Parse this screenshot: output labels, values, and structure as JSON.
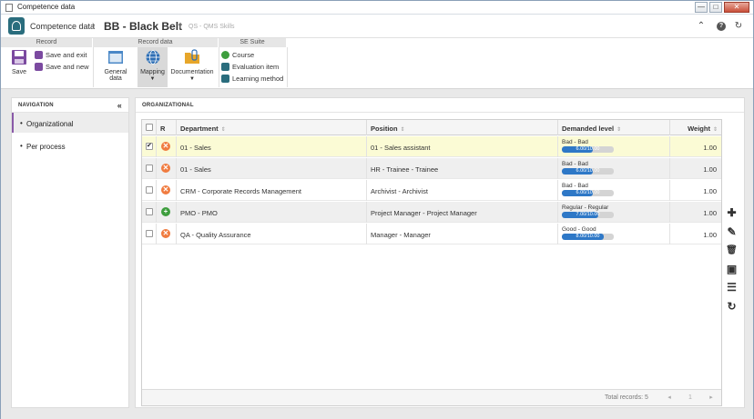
{
  "window": {
    "title": "Competence data",
    "min_label": "—",
    "max_label": "□",
    "close_label": "✕"
  },
  "header": {
    "crumb_home": "Competence data",
    "separator": "›",
    "title": "BB - Black Belt",
    "pipe": "|",
    "subtitle": "QS - QMS Skills",
    "up_icon": "⌃",
    "help_icon": "?",
    "refresh_icon": "↻"
  },
  "ribbon": {
    "groups": {
      "record": "Record",
      "record_data": "Record data",
      "se_suite": "SE Suite"
    },
    "save": "Save",
    "save_and_exit": "Save and exit",
    "save_and_new": "Save and new",
    "general_data": "General data",
    "mapping": "Mapping",
    "documentation": "Documentation",
    "course": "Course",
    "evaluation_item": "Evaluation item",
    "learning_method": "Learning method"
  },
  "navigation": {
    "title": "NAVIGATION",
    "collapse_icon": "«",
    "items": [
      {
        "label": "Organizational",
        "active": true
      },
      {
        "label": "Per process",
        "active": false
      }
    ]
  },
  "panel": {
    "title": "ORGANIZATIONAL"
  },
  "grid": {
    "columns": {
      "r": "R",
      "department": "Department",
      "position": "Position",
      "demanded_level": "Demanded level",
      "weight": "Weight"
    },
    "sort_glyph": "⇕",
    "rows": [
      {
        "checked": true,
        "status": "bad",
        "status_glyph": "✕",
        "department": "01 - Sales",
        "position": "01 - Sales assistant",
        "level_label": "Bad - Bad",
        "level_value": "6.00/10.00",
        "level_fraction": 0.6,
        "weight": "1.00"
      },
      {
        "checked": false,
        "status": "bad",
        "status_glyph": "✕",
        "department": "01 - Sales",
        "position": "HR - Trainee - Trainee",
        "level_label": "Bad - Bad",
        "level_value": "6.00/10.00",
        "level_fraction": 0.6,
        "weight": "1.00"
      },
      {
        "checked": false,
        "status": "bad",
        "status_glyph": "✕",
        "department": "CRM - Corporate Records Management",
        "position": "Archivist - Archivist",
        "level_label": "Bad - Bad",
        "level_value": "6.00/10.00",
        "level_fraction": 0.6,
        "weight": "1.00"
      },
      {
        "checked": false,
        "status": "good",
        "status_glyph": "+",
        "department": "PMO - PMO",
        "position": "Project Manager - Project Manager",
        "level_label": "Regular - Regular",
        "level_value": "7.00/10.00",
        "level_fraction": 0.7,
        "weight": "1.00"
      },
      {
        "checked": false,
        "status": "bad",
        "status_glyph": "✕",
        "department": "QA - Quality Assurance",
        "position": "Manager - Manager",
        "level_label": "Good - Good",
        "level_value": "8.00/10.00",
        "level_fraction": 0.8,
        "weight": "1.00"
      }
    ],
    "footer": {
      "total": "Total records: 5",
      "prev_icon": "◂",
      "page": "1",
      "next_icon": "▸"
    }
  },
  "toolbar": {
    "add_icon": "✚",
    "edit_icon": "✎",
    "delete_icon": "🗑",
    "view_icon": "▣",
    "list_icon": "☰",
    "refresh_icon": "↻"
  },
  "colors": {
    "accent": "#2a6d7d",
    "selected_row": "#fbfbd5",
    "bar": "#2e78c7",
    "bad": "#f07b3f",
    "good": "#3e9e3e"
  }
}
